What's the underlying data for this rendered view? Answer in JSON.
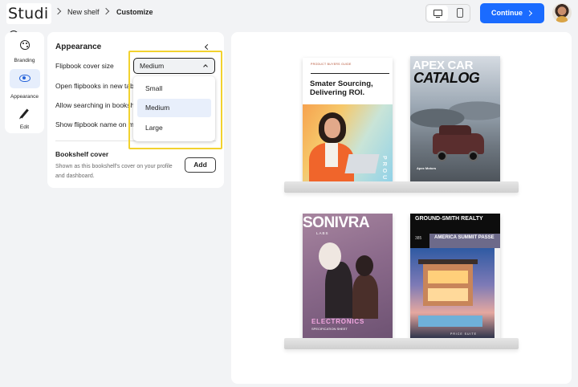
{
  "app": {
    "logo_text": "Studi"
  },
  "breadcrumb": {
    "items": [
      "New shelf",
      "Customize"
    ]
  },
  "header": {
    "device_options": [
      "desktop-icon",
      "mobile-icon"
    ],
    "active_device": "desktop",
    "continue_label": "Continue"
  },
  "rail": {
    "items": [
      {
        "label": "Branding",
        "icon": "palette-icon"
      },
      {
        "label": "Appearance",
        "icon": "eye-icon",
        "active": true
      },
      {
        "label": "Edit",
        "icon": "pencil-icon"
      }
    ]
  },
  "appearance": {
    "title": "Appearance",
    "rows": [
      "Flipbook cover size",
      "Open flipbooks in new tab",
      "Allow searching in bookshelf",
      "Show flipbook name on mouse over"
    ],
    "cover_size": {
      "value": "Medium",
      "options": [
        "Small",
        "Medium",
        "Large"
      ]
    },
    "bookshelf_cover": {
      "title": "Bookshelf cover",
      "description": "Shown as this bookshelf's cover on your profile and dashboard.",
      "add_label": "Add"
    }
  },
  "shelf": {
    "books": [
      {
        "kicker": "PRODUCT BUYERS GUIDE",
        "headline": "Smater Sourcing, Delivering ROI.",
        "vertical_text": "PROU"
      },
      {
        "title_line1": "APEX CAR",
        "title_line2": "CATALOG",
        "brand": "Apex Motors"
      },
      {
        "title": "SONIVRA",
        "subtitle": "LABS",
        "category": "ELECTRONICS",
        "footer": "SPECIFICATION SHEET"
      },
      {
        "title": "GROUND-SMITH REALTY",
        "number": "385",
        "band_text": "AMERICA SUMMIT PASSE",
        "footer": "PRICE   SUITE"
      }
    ]
  },
  "colors": {
    "accent": "#1a6bff",
    "highlight": "#f2d22e",
    "selected_bg": "#e8effb"
  }
}
